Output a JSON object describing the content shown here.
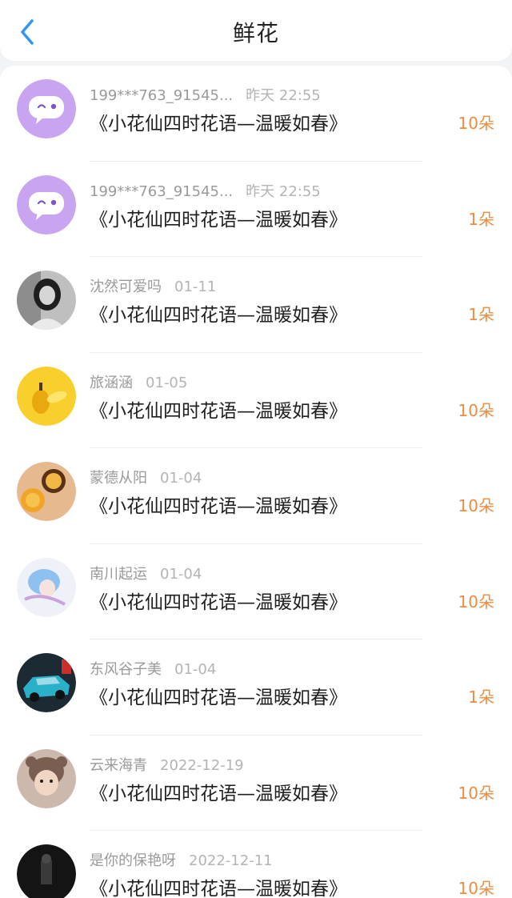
{
  "header": {
    "title": "鲜花",
    "back_icon": "chevron-left-icon",
    "accent": "#2f97f3"
  },
  "colors": {
    "count": "#ec8c3e"
  },
  "rows": [
    {
      "user": "199***763_91545...",
      "time": "昨天 22:55",
      "gift": "《小花仙四时花语—温暖如春》",
      "count": "10朵",
      "avatar": "chat-bubble-avatar"
    },
    {
      "user": "199***763_91545...",
      "time": "昨天 22:55",
      "gift": "《小花仙四时花语—温暖如春》",
      "count": "1朵",
      "avatar": "chat-bubble-avatar"
    },
    {
      "user": "沈然可爱吗",
      "time": "01-11",
      "gift": "《小花仙四时花语—温暖如春》",
      "count": "1朵",
      "avatar": "grayscale-portrait-avatar"
    },
    {
      "user": "旅涵涵",
      "time": "01-05",
      "gift": "《小花仙四时花语—温暖如春》",
      "count": "10朵",
      "avatar": "yellow-fruit-avatar"
    },
    {
      "user": "蒙德从阳",
      "time": "01-04",
      "gift": "《小花仙四时花语—温暖如春》",
      "count": "10朵",
      "avatar": "mooncake-avatar"
    },
    {
      "user": "南川起运",
      "time": "01-04",
      "gift": "《小花仙四时花语—温暖如春》",
      "count": "10朵",
      "avatar": "anime-girl-avatar"
    },
    {
      "user": "东风谷子美",
      "time": "01-04",
      "gift": "《小花仙四时花语—温暖如春》",
      "count": "1朵",
      "avatar": "toy-car-avatar"
    },
    {
      "user": "云来海青",
      "time": "2022-12-19",
      "gift": "《小花仙四时花语—温暖如春》",
      "count": "10朵",
      "avatar": "child-portrait-avatar"
    },
    {
      "user": "是你的保艳呀",
      "time": "2022-12-11",
      "gift": "《小花仙四时花语—温暖如春》",
      "count": "10朵",
      "avatar": "dark-photo-avatar"
    }
  ]
}
